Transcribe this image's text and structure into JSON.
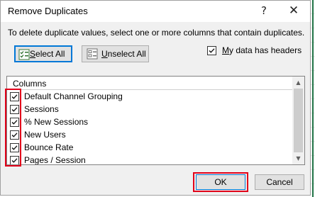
{
  "dialog": {
    "title": "Remove Duplicates",
    "help_glyph": "?",
    "close_glyph": "✕",
    "instructions": "To delete duplicate values, select one or more columns that contain duplicates."
  },
  "buttons": {
    "select_all": {
      "mnemonic": "S",
      "rest": "elect All"
    },
    "unselect_all": {
      "mnemonic": "U",
      "rest": "nselect All"
    },
    "ok": "OK",
    "cancel": "Cancel"
  },
  "headers_option": {
    "mnemonic": "M",
    "rest": "y data has headers",
    "checked": true
  },
  "columns": {
    "header": "Columns",
    "items": [
      {
        "label": "Default Channel Grouping",
        "checked": true
      },
      {
        "label": "Sessions",
        "checked": true
      },
      {
        "label": "% New Sessions",
        "checked": true
      },
      {
        "label": "New Users",
        "checked": true
      },
      {
        "label": "Bounce Rate",
        "checked": true
      },
      {
        "label": "Pages / Session",
        "checked": true
      }
    ]
  },
  "scrollbar": {
    "up_glyph": "▲",
    "down_glyph": "▼"
  },
  "colors": {
    "highlight": "#e1001a",
    "accent": "#0078d7"
  }
}
